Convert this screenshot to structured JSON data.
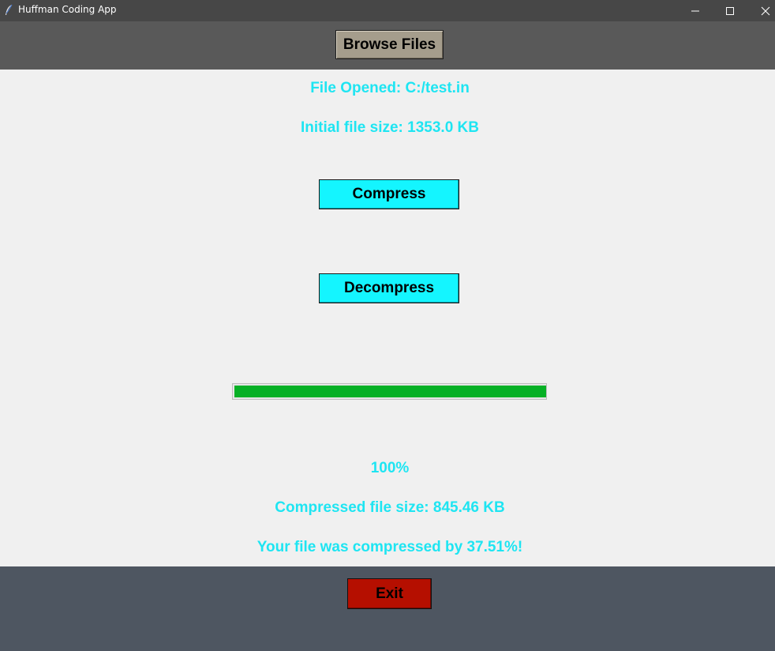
{
  "window": {
    "title": "Huffman Coding App",
    "icons": {
      "app": "feather-icon",
      "minimize": "minimize-icon",
      "maximize": "maximize-icon",
      "close": "close-icon"
    }
  },
  "toolbar": {
    "browse_label": "Browse Files"
  },
  "main": {
    "file_opened": "File Opened: C:/test.in",
    "initial_size": "Initial file size: 1353.0 KB",
    "compress_label": "Compress",
    "decompress_label": "Decompress",
    "progress_percent": 100,
    "progress_text": "100%",
    "compressed_size": "Compressed file size: 845.46 KB",
    "compressed_message": "Your file was compressed by 37.51%!"
  },
  "footer": {
    "exit_label": "Exit"
  },
  "colors": {
    "accent_text": "#1ee5f2",
    "button_cyan": "#14f5ff",
    "browse_button": "#a59d8c",
    "exit_button": "#b50f00",
    "progress_fill": "#06b025",
    "titlebar": "#474747",
    "toolbar": "#595959",
    "footer": "#4e5661"
  }
}
